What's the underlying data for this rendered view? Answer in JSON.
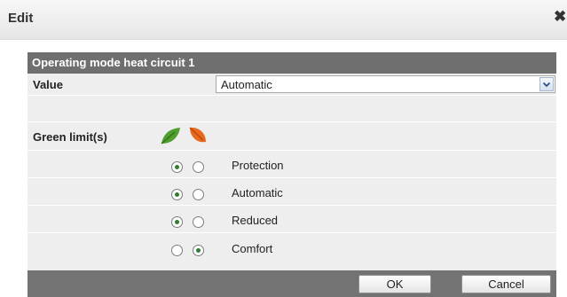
{
  "dialog": {
    "title": "Edit",
    "close_glyph": "✖"
  },
  "panel": {
    "header": "Operating mode heat circuit 1",
    "value_label": "Value",
    "value_selected": "Automatic",
    "green_limits_label": "Green limit(s)",
    "icons": [
      "green-leaf-icon",
      "orange-leaf-icon"
    ],
    "modes": [
      {
        "label": "Protection",
        "green_selected": true
      },
      {
        "label": "Automatic",
        "green_selected": true
      },
      {
        "label": "Reduced",
        "green_selected": true
      },
      {
        "label": "Comfort",
        "green_selected": false
      }
    ]
  },
  "buttons": {
    "ok": "OK",
    "cancel": "Cancel"
  },
  "colors": {
    "header_bg": "#6f6f6f",
    "panel_bg": "#eeeeee",
    "radio_dot": "#2e7d32",
    "green_leaf": "#4f9e2e",
    "orange_leaf": "#e8691c"
  }
}
